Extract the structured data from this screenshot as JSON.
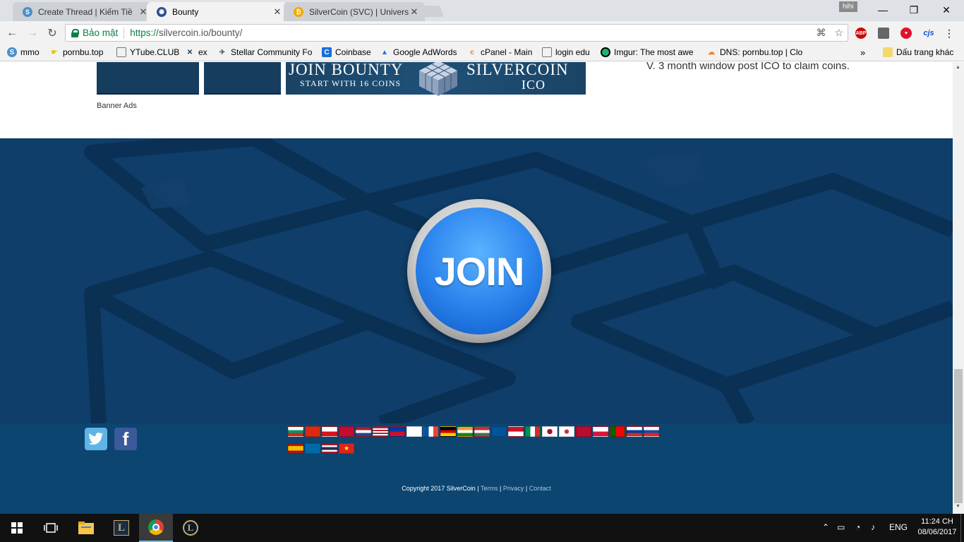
{
  "browser": {
    "tabs": [
      {
        "title": "Create Thread | Kiếm Tiề",
        "icon": "silvercoin-favicon",
        "color": "#4a90c8"
      },
      {
        "title": "Bounty",
        "icon": "globe-favicon",
        "color": "#2b4d8f"
      },
      {
        "title": "SilverCoin (SVC) | Univers",
        "icon": "bitcoin-favicon",
        "color": "#f2a900"
      }
    ],
    "profile_label": "hihi",
    "security_label": "Bảo mật",
    "url_scheme": "https://",
    "url_rest": "silvercoin.io/bounty/",
    "bookmarks": [
      {
        "label": "mmo",
        "icon": "silvercoin-icon"
      },
      {
        "label": "pornbu.top",
        "icon": "hand-icon"
      },
      {
        "label": "YTube.CLUB",
        "icon": "page-icon"
      },
      {
        "label": "ex",
        "icon": "x-logo-icon"
      },
      {
        "label": "Stellar Community Fo",
        "icon": "stellar-icon"
      },
      {
        "label": "Coinbase",
        "icon": "coinbase-icon"
      },
      {
        "label": "Google AdWords",
        "icon": "adwords-icon"
      },
      {
        "label": "cPanel - Main",
        "icon": "cpanel-icon"
      },
      {
        "label": "login edu",
        "icon": "page-icon"
      },
      {
        "label": "Imgur: The most awe",
        "icon": "imgur-icon"
      },
      {
        "label": "DNS: pornbu.top | Clo",
        "icon": "cloudflare-icon"
      }
    ],
    "more_bookmarks": "»",
    "other_bookmarks": "Dấu trang khác",
    "extension_abp": "ABP",
    "extension_cjs": "cjs"
  },
  "page": {
    "banner_top_text": "JOIN BOUNTY",
    "banner_sub_text": "START WITH 16 COINS",
    "banner_brand": "SILVERCOIN",
    "banner_ico": "ICO",
    "banner_label": "Banner Ads",
    "claim_text": "V. 3 month window post ICO to claim coins.",
    "join_label": "JOIN",
    "flags": [
      "bg",
      "cn",
      "cz",
      "dk",
      "nl",
      "us",
      "ph",
      "fi",
      "fr",
      "de",
      "in",
      "hu",
      "is",
      "id",
      "it",
      "jp",
      "kr",
      "no",
      "pl",
      "pt",
      "ru",
      "sk",
      "es",
      "se",
      "th",
      "vn"
    ],
    "footer": {
      "copyright": "Copyright 2017 SilverCoin",
      "terms": "Terms",
      "privacy": "Privacy",
      "contact": "Contact",
      "separator": "|"
    }
  },
  "taskbar": {
    "language": "ENG",
    "time": "11:24 CH",
    "date": "08/06/2017"
  }
}
